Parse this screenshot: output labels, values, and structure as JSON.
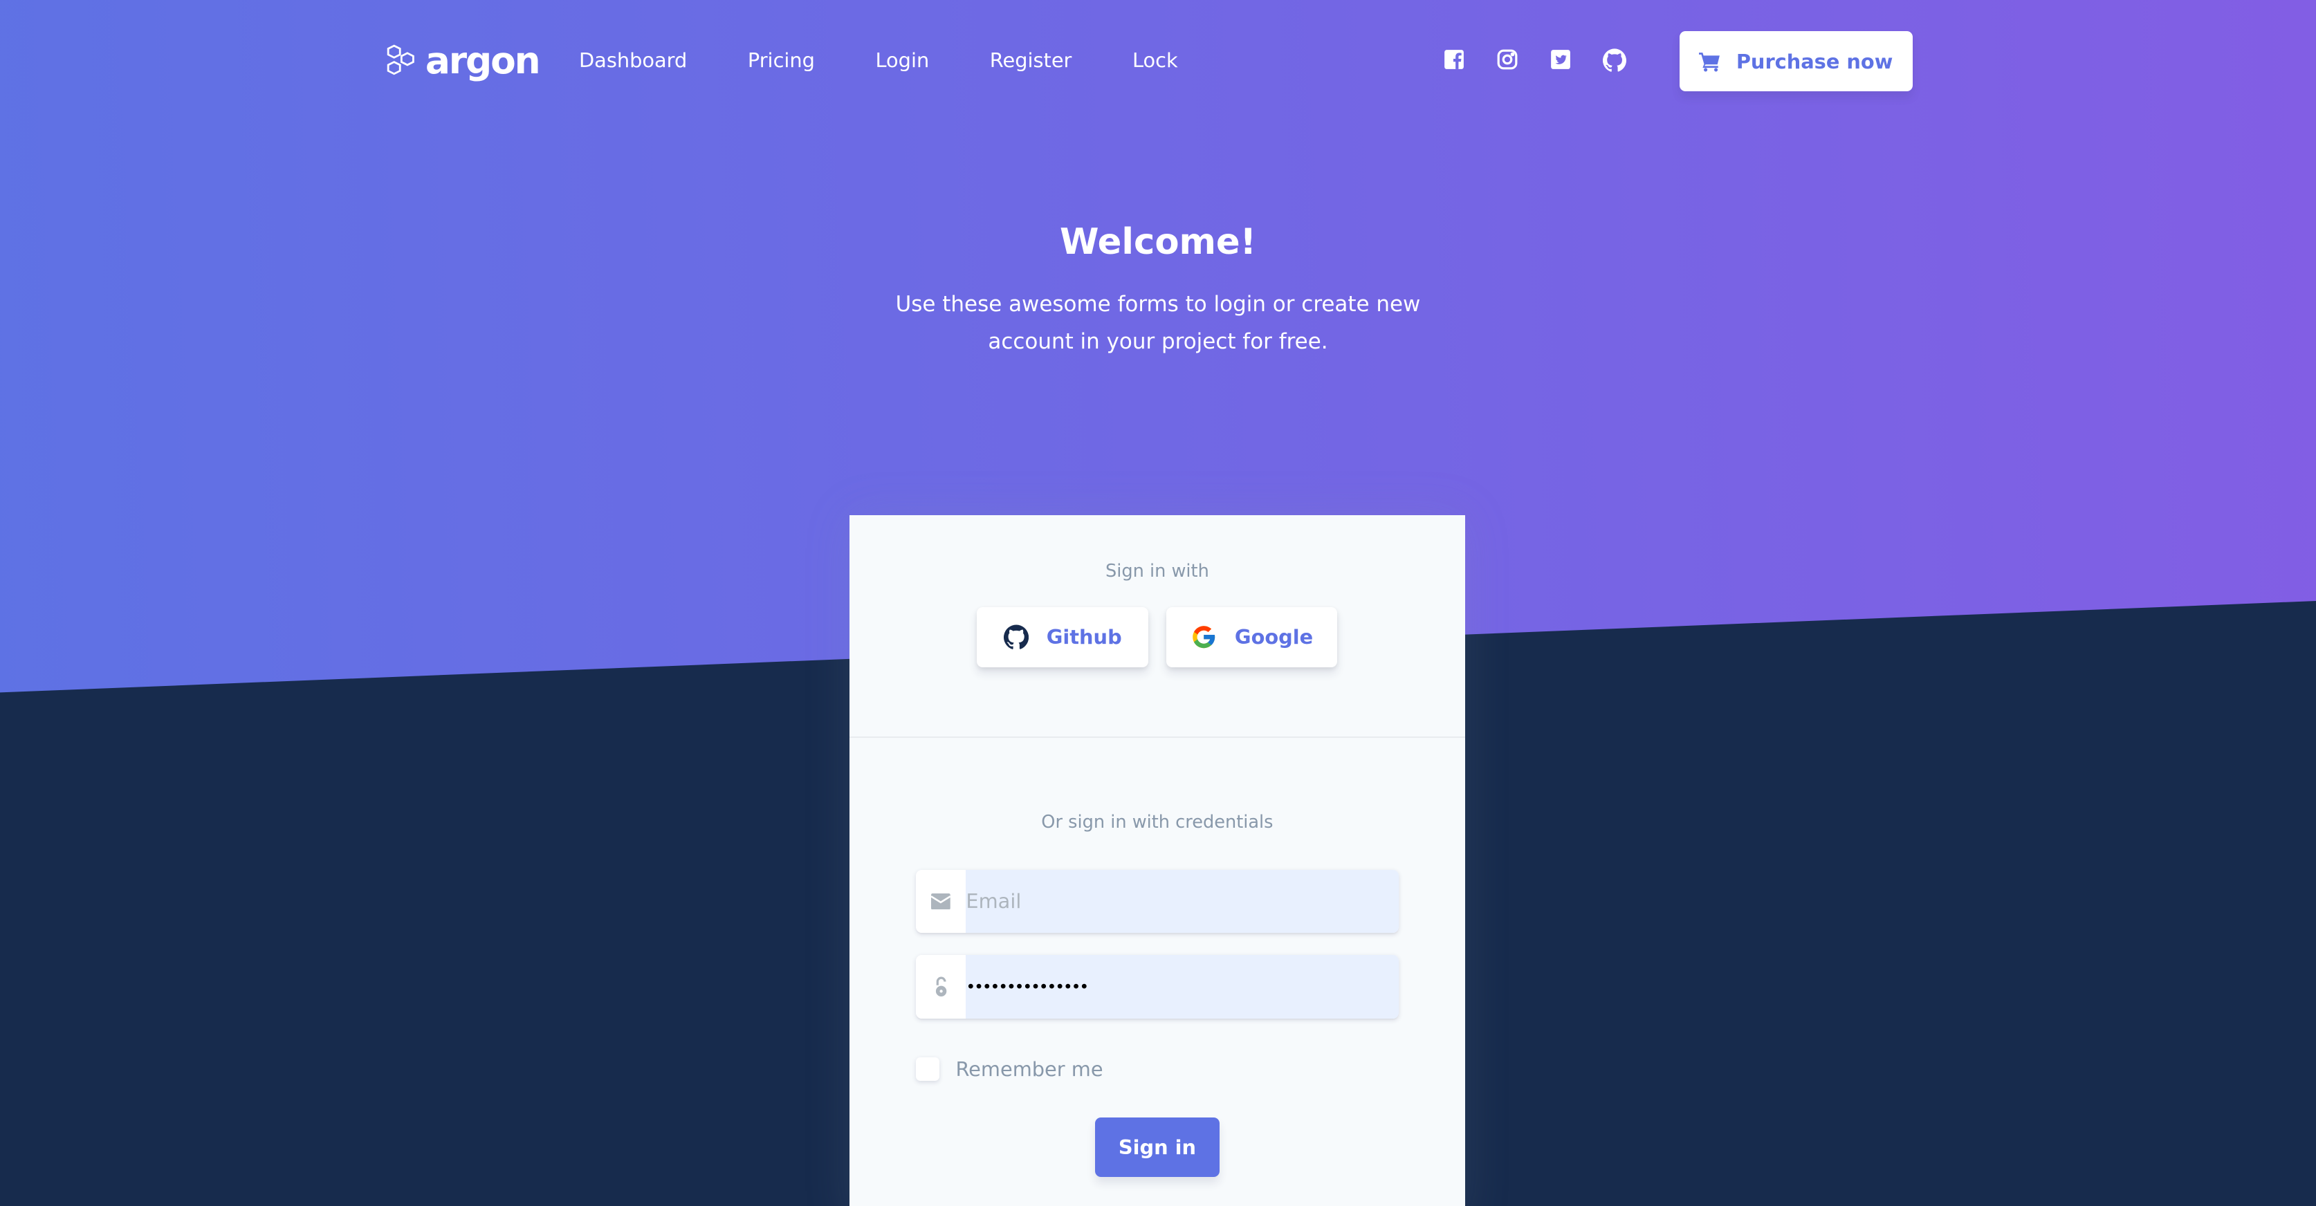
{
  "brand": {
    "name": "argon"
  },
  "nav": {
    "links": [
      "Dashboard",
      "Pricing",
      "Login",
      "Register",
      "Lock"
    ],
    "social": [
      "facebook-icon",
      "instagram-icon",
      "twitter-icon",
      "github-icon"
    ],
    "purchase_label": "Purchase now"
  },
  "hero": {
    "title": "Welcome!",
    "subtitle": "Use these awesome forms to login or create new account in your project for free."
  },
  "card": {
    "social_heading": "Sign in with",
    "github_label": "Github",
    "google_label": "Google",
    "credentials_heading": "Or sign in with credentials",
    "email_placeholder": "Email",
    "email_value": "",
    "password_value": "•••••••••••••••",
    "remember_label": "Remember me",
    "remember_checked": false,
    "signin_label": "Sign in"
  },
  "colors": {
    "primary": "#5e72e4",
    "gradient_end": "#825ee4",
    "dark": "#172b4d"
  }
}
